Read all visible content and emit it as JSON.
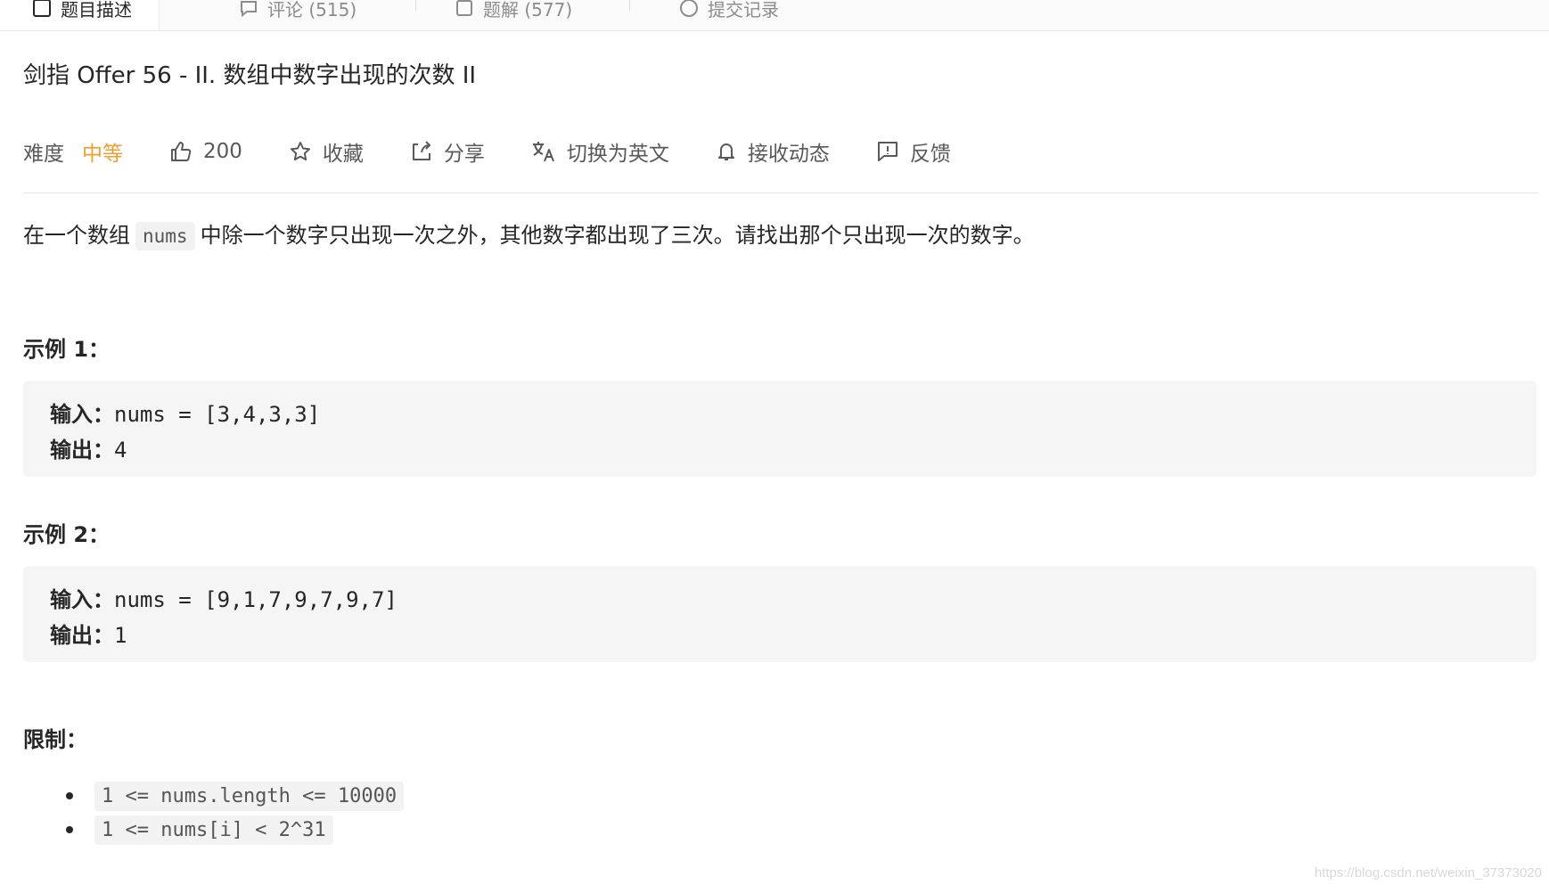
{
  "tabs": [
    {
      "label": "题目描述",
      "icon": "description-icon",
      "active": true
    },
    {
      "label": "评论 (515)",
      "icon": "comment-icon",
      "active": false
    },
    {
      "label": "题解 (577)",
      "icon": "solution-icon",
      "active": false
    },
    {
      "label": "提交记录",
      "icon": "history-icon",
      "active": false
    }
  ],
  "problem": {
    "title": "剑指 Offer 56 - II. 数组中数字出现的次数 II",
    "difficulty_label": "难度",
    "difficulty_value": "中等",
    "likes": "200",
    "favorite_label": "收藏",
    "share_label": "分享",
    "switch_lang_label": "切换为英文",
    "subscribe_label": "接收动态",
    "feedback_label": "反馈"
  },
  "description": {
    "before": "在一个数组",
    "code": "nums",
    "after": "中除一个数字只出现一次之外，其他数字都出现了三次。请找出那个只出现一次的数字。"
  },
  "examples": [
    {
      "title": "示例 1：",
      "input_label": "输入：",
      "input": "nums = [3,4,3,3]",
      "output_label": "输出：",
      "output": "4"
    },
    {
      "title": "示例 2：",
      "input_label": "输入：",
      "input": "nums = [9,1,7,9,7,9,7]",
      "output_label": "输出：",
      "output": "1"
    }
  ],
  "limits": {
    "title": "限制：",
    "items": [
      "1 <= nums.length <= 10000",
      "1 <= nums[i] < 2^31"
    ]
  },
  "watermark": "https://blog.csdn.net/weixin_37373020",
  "colors": {
    "difficulty_medium": "#ef9e2f",
    "code_bg": "#f2f2f2",
    "example_bg": "#f5f5f5"
  }
}
